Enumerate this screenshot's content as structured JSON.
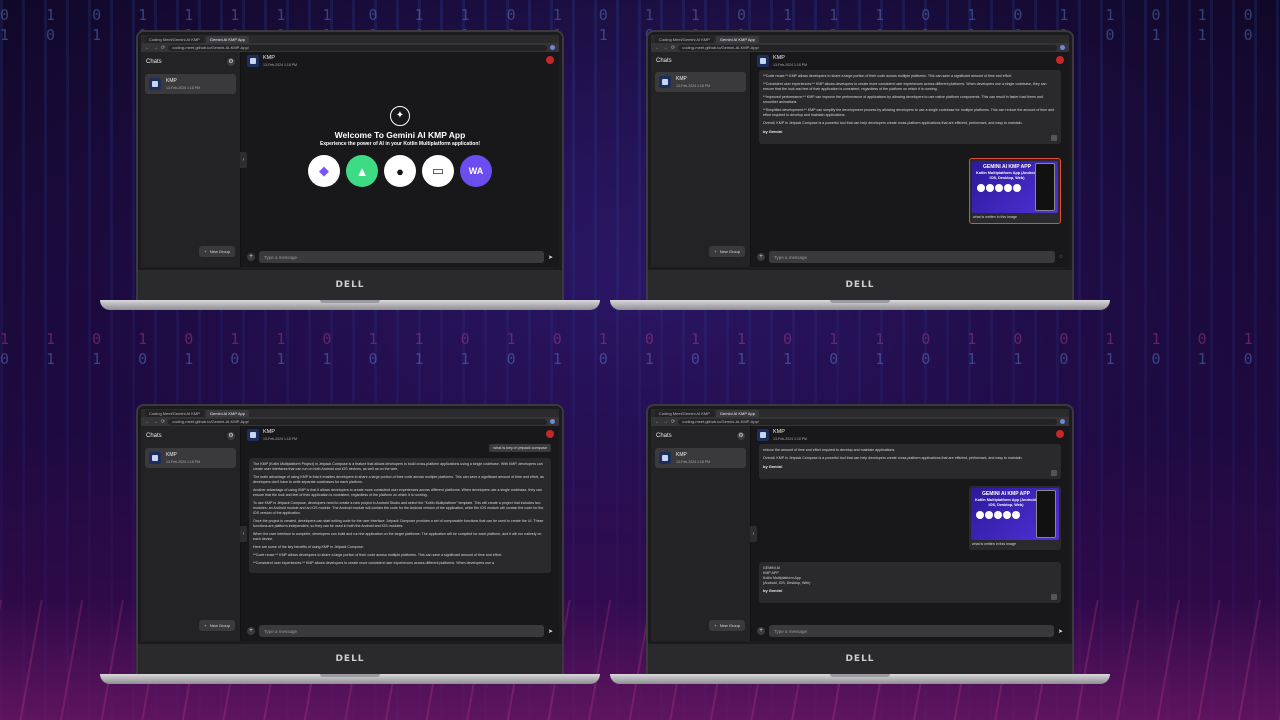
{
  "background": {
    "binary_rows": [
      "0 1 0 1 1 1 1 1 0 1 1 0 1 0 1 1 0 1 1 1 0 1 0 1 1 0 1 0",
      "1 0 1 0 1 0 0 1 1 0 1 0 1 1 0 0 1 0 1 0 1 1 0 1 0 1 1 0",
      "1 1 0 1 0 1 1 0 1 1 0 1 0 1 0 1 1 0 1 1 0 1 0 0 1 1 0 1",
      "0 1 1 0 1 0 1 1 0 1 1 0 1 0 1 0 1 1 0 1 0 1 1 0 1 0 1 0"
    ]
  },
  "browser": {
    "tabs": [
      "Coding Meet/Gemini AI KMP",
      "Gemini AI KMP App"
    ],
    "url": "coding-meet.github.io/Gemini-AI-KMP-App/"
  },
  "brand": "DELL",
  "app": {
    "sidebar_title": "Chats",
    "chat": {
      "name": "KMP",
      "time": "13-Feb-2024 1:18 PM"
    },
    "header_time": "13-Feb-2024 1:18 PM",
    "new_group": "New Group",
    "input_placeholder": "Type a message"
  },
  "welcome": {
    "title": "Welcome To Gemini AI KMP App",
    "subtitle": "Experience the power of AI in your Kotlin Multiplatform application!",
    "platforms": [
      "kotlin-icon",
      "android-icon",
      "apple-icon",
      "desktop-icon",
      "wasm-icon"
    ],
    "wasm_label": "WA"
  },
  "messages": {
    "by": "by Gemini",
    "question": "what is kmp in jetpack compose",
    "image_caption": "what is written in this image",
    "poster_title": "GEMINI AI KMP APP",
    "poster_sub": "Kotlin Multiplatform App (Android, IOS, Desktop, Web)",
    "answer_paras": [
      "The KMP (Kotlin Multiplatform Project) in Jetpack Compose is a feature that allows developers to build cross-platform applications using a single codebase. With KMP, developers can create user interfaces that can run on both Android and iOS devices, as well as on the web.",
      "The main advantage of using KMP is that it enables developers to share a large portion of their code across multiple platforms. This can save a significant amount of time and effort, as developers don't have to write separate codebases for each platform.",
      "Another advantage of using KMP is that it allows developers to create more consistent user experiences across different platforms. When developers use a single codebase, they can ensure that the look and feel of their application is consistent, regardless of the platform on which it is running.",
      "To use KMP in Jetpack Compose, developers need to create a new project in Android Studio and select the \"Kotlin Multiplatform\" template. This will create a project that includes two modules: an Android module and an iOS module. The Android module will contain the code for the Android version of the application, while the iOS module will contain the code for the iOS version of the application.",
      "Once the project is created, developers can start writing code for the user interface. Jetpack Compose provides a set of composable functions that can be used to create the UI. These functions are platform-independent, so they can be used in both the Android and iOS modules.",
      "When the user interface is complete, developers can build and run the application on the target platforms. The application will be compiled for each platform, and it will run natively on each device.",
      "Here are some of the key benefits of using KMP in Jetpack Compose:",
      "**Code reuse:** KMP allows developers to share a large portion of their code across multiple platforms. This can save a significant amount of time and effort.",
      "**Consistent user experiences:** KMP allows developers to create more consistent user experiences across different platforms. When developers use a"
    ],
    "benefits_paras": [
      "**Code reuse:** KMP allows developers to share a large portion of their code across multiple platforms. This can save a significant amount of time and effort.",
      "**Consistent user experiences:** KMP allows developers to create more consistent user experiences across different platforms. When developers use a single codebase, they can ensure that the look and feel of their application is consistent, regardless of the platform on which it is running.",
      "**Improved performance:** KMP can improve the performance of applications by allowing developers to use native platform components. This can result in faster load times and smoother animations.",
      "**Simplified development:** KMP can simplify the development process by allowing developers to use a single codebase for multiple platforms. This can reduce the amount of time and effort required to develop and maintain applications."
    ],
    "overall": "Overall, KMP in Jetpack Compose is a powerful tool that can help developers create cross-platform applications that are efficient, performant, and easy to maintain.",
    "tail_line": "reduce the amount of time and effort required to develop and maintain applications.",
    "ocr_answer": [
      "GEMINI AI",
      "KMP APP",
      "Kotlin Multiplatform App",
      "(Android, IOS, Desktop, Web)"
    ]
  }
}
